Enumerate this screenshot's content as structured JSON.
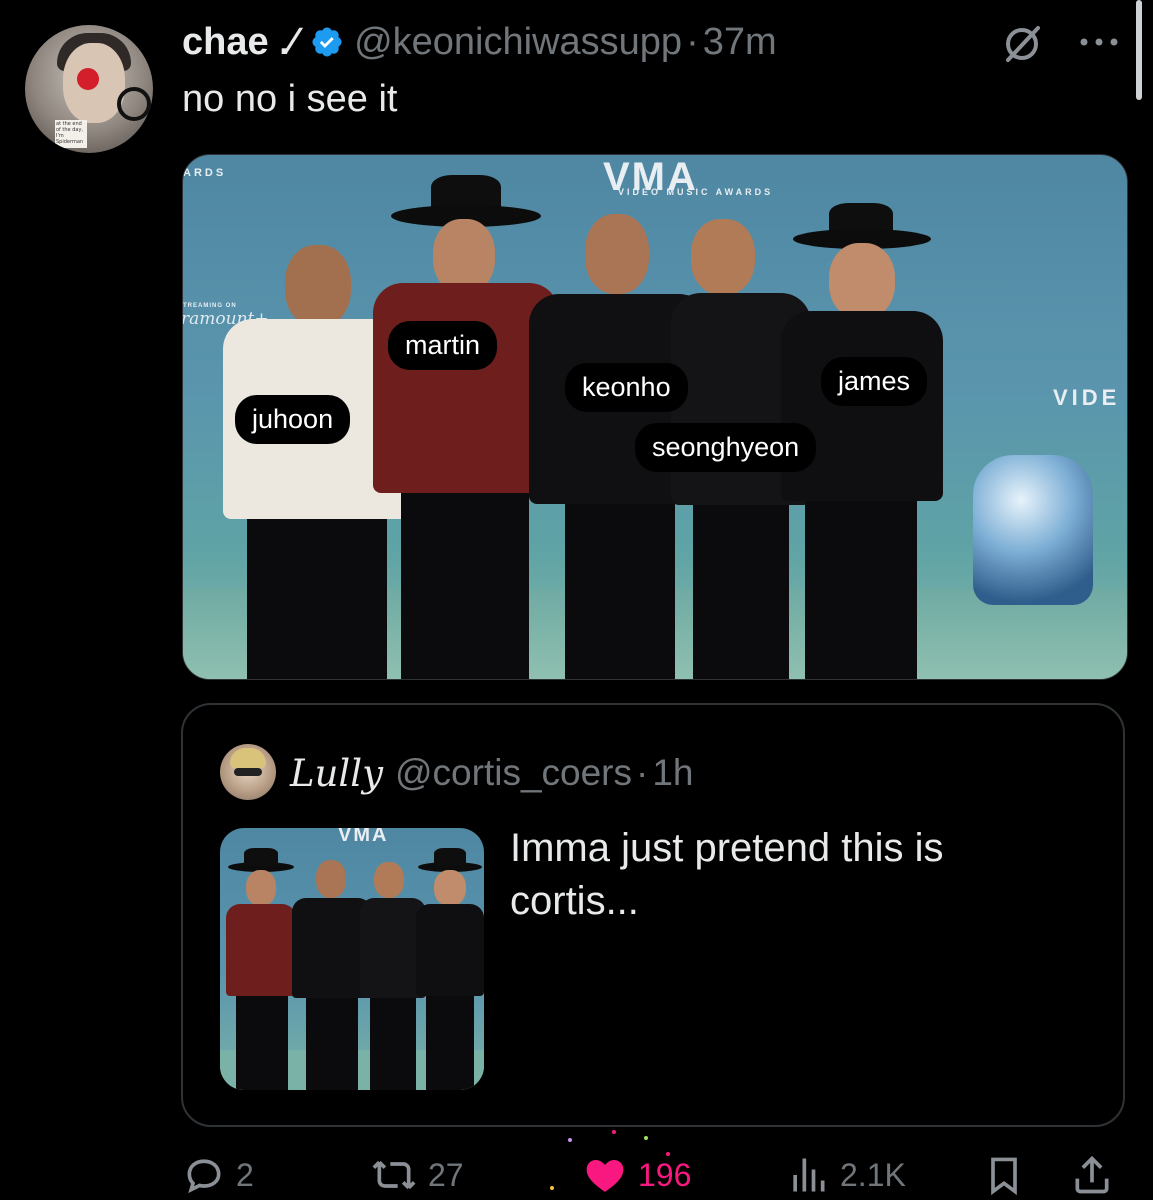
{
  "tweet": {
    "display_name": "chae .⁄",
    "handle": "@keonichiwassupp",
    "separator": "·",
    "time": "37m",
    "text": "no no i see it",
    "avatar_note": "at the end of the day, I'm Spiderman"
  },
  "media": {
    "backdrop_words": {
      "vma": "VMA",
      "video_music_awards": "VIDEO MUSIC AWARDS",
      "awards": "ARDS",
      "streaming_on": "TREAMING ON",
      "paramount": "ramount+",
      "vide": "VIDE"
    },
    "tags": [
      "juhoon",
      "martin",
      "keonho",
      "seonghyeon",
      "james"
    ]
  },
  "quote": {
    "display_name": "Lully",
    "handle": "@cortis_coers",
    "separator": "·",
    "time": "1h",
    "text": "Imma just pretend this is cortis...",
    "media_logo": "VMA"
  },
  "actions": {
    "reply_count": "2",
    "repost_count": "27",
    "like_count": "196",
    "views_count": "2.1K"
  },
  "icons": {
    "verified": "verified-badge-icon",
    "grok": "grok-icon",
    "more": "more-icon",
    "reply": "reply-icon",
    "repost": "repost-icon",
    "like": "heart-icon",
    "views": "views-icon",
    "bookmark": "bookmark-icon",
    "share": "share-icon"
  },
  "colors": {
    "background": "#000000",
    "text": "#e7e9ea",
    "muted": "#71767b",
    "verified_blue": "#1d9bf0",
    "like_pink": "#f91880",
    "border": "#2f3336"
  }
}
